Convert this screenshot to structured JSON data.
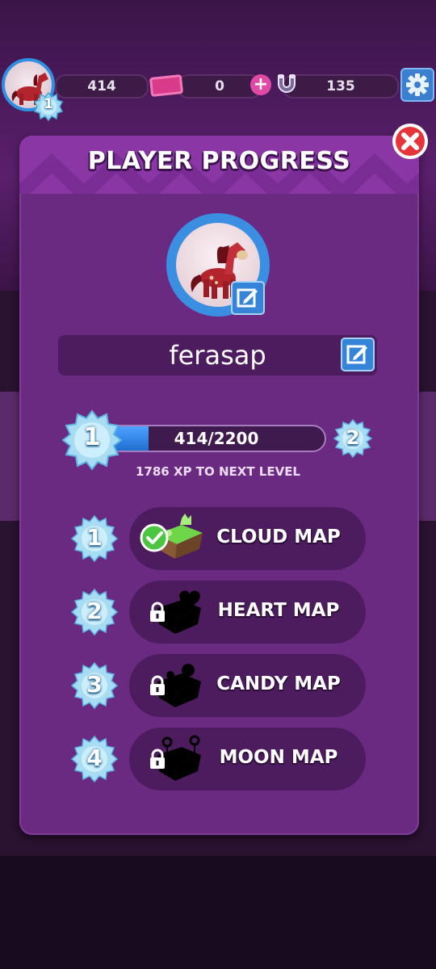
{
  "hud": {
    "xp_value": "414",
    "tickets_value": "0",
    "magnets_value": "135",
    "player_level": "1"
  },
  "dialog": {
    "title": "PLAYER PROGRESS",
    "player_name": "ferasap",
    "current_level": "1",
    "next_level": "2",
    "xp_progress_text": "414/2200",
    "xp_progress_fraction": 0.188,
    "xp_to_next_text": "1786 XP TO NEXT LEVEL"
  },
  "maps": [
    {
      "level": "1",
      "name": "CLOUD MAP",
      "status": "unlocked"
    },
    {
      "level": "2",
      "name": "HEART MAP",
      "status": "locked"
    },
    {
      "level": "3",
      "name": "CANDY MAP",
      "status": "locked"
    },
    {
      "level": "4",
      "name": "MOON MAP",
      "status": "locked"
    }
  ],
  "colors": {
    "panel": "#6b2a82",
    "panel_dark": "#4d1c5e",
    "accent_blue": "#3584d8",
    "close_red": "#e5353b",
    "check_green": "#4cc640"
  },
  "icons": {
    "settings": "gear-icon",
    "close": "close-icon",
    "edit": "edit-icon",
    "lock": "lock-icon",
    "check": "check-icon",
    "magnet": "magnet-icon",
    "ticket": "ticket-icon"
  }
}
